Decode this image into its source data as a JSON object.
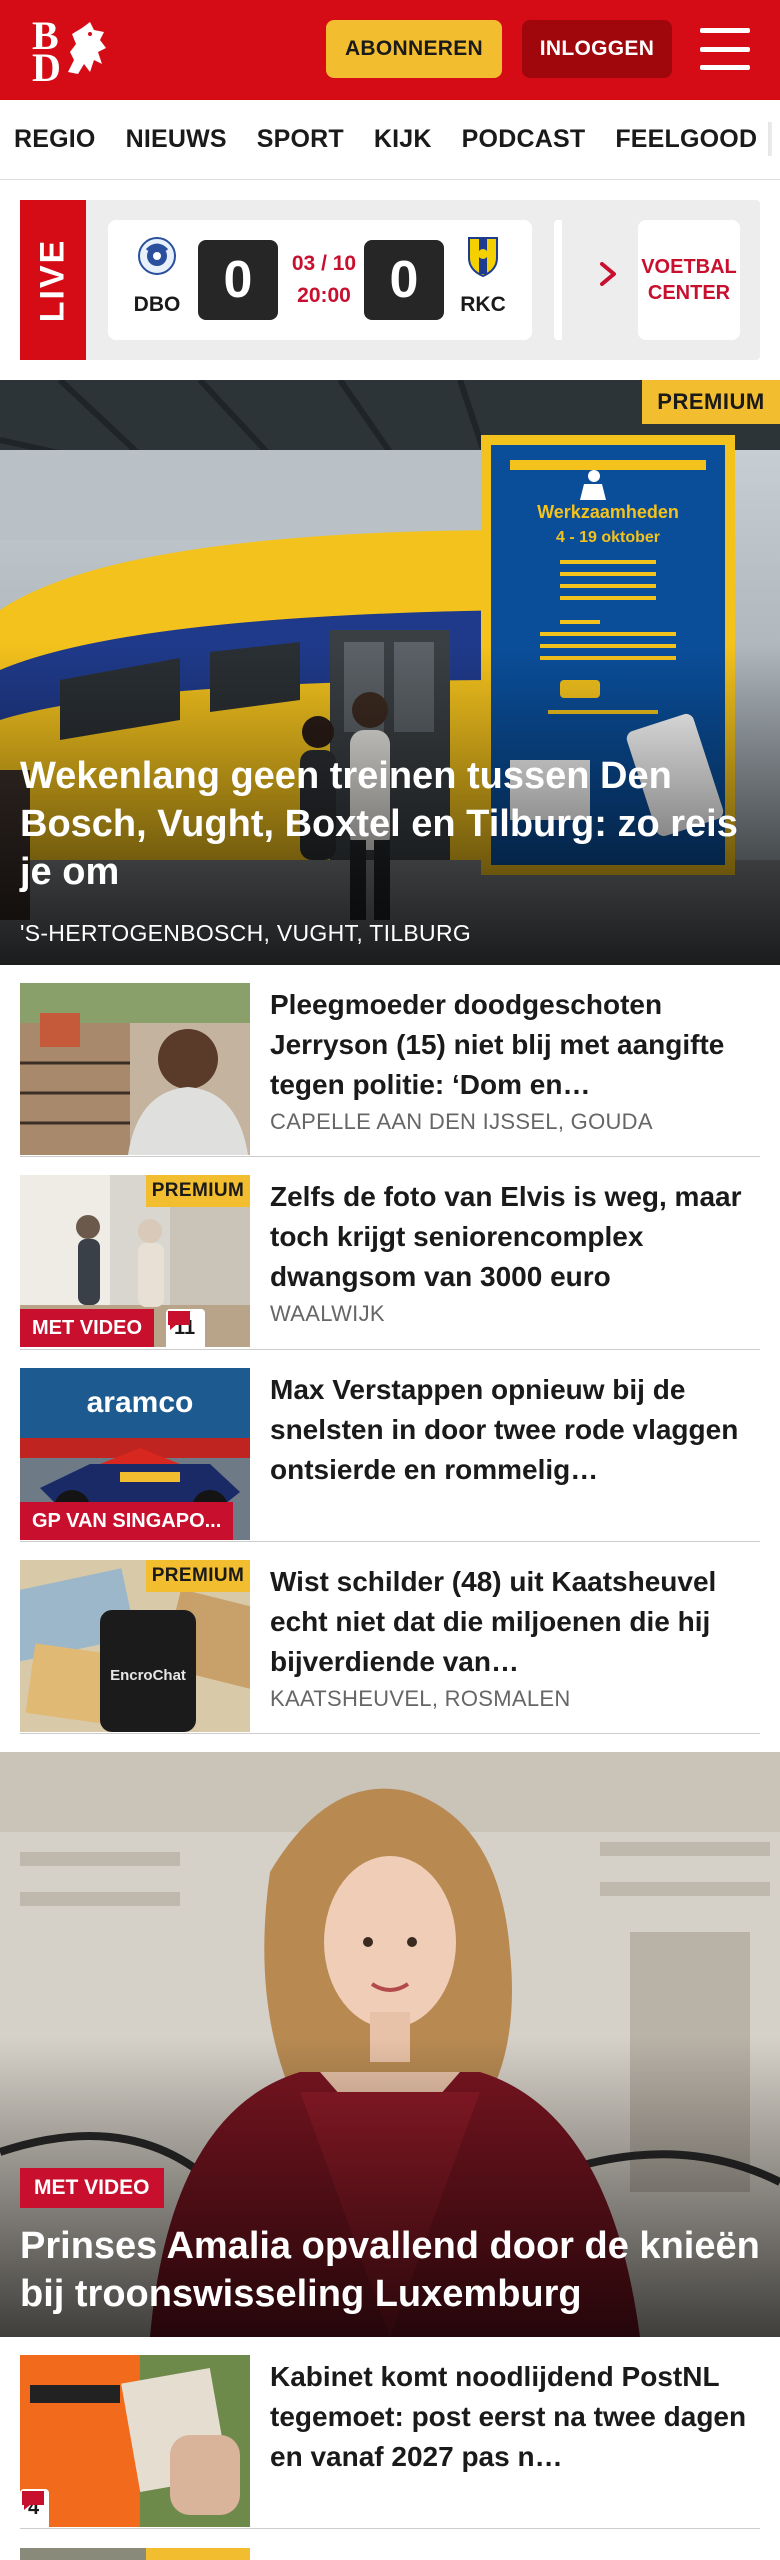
{
  "header": {
    "logo_text": "BD",
    "subscribe_label": "ABONNEREN",
    "login_label": "INLOGGEN",
    "brand_color": "#d50c16"
  },
  "nav": {
    "items": [
      "REGIO",
      "NIEUWS",
      "SPORT",
      "KIJK",
      "PODCAST",
      "FEELGOOD"
    ]
  },
  "live": {
    "label": "LIVE",
    "match": {
      "home": "DBO",
      "away": "RKC",
      "home_score": "0",
      "away_score": "0",
      "date": "03 / 10",
      "time": "20:00"
    },
    "voetbal_center": "VOETBAL CENTER"
  },
  "hero": {
    "badge": "PREMIUM",
    "title": "Wekenlang geen treinen tussen Den Bosch, Vught, Boxtel en Tilburg: zo reis je om",
    "location": "'S-HERTOGENBOSCH, VUGHT, TILBURG",
    "sign_title": "Werkzaamheden 4 - 19 oktober"
  },
  "articles": [
    {
      "title": "Pleegmoeder doodgeschoten Jerryson (15) niet blij met aangifte tegen politie: ‘Dom en…",
      "location": "CAPELLE AAN DEN IJSSEL, GOUDA"
    },
    {
      "title": "Zelfs de foto van Elvis is weg, maar toch krijgt seniorencom­plex dwangsom van 3000 euro",
      "location": "WAALWIJK",
      "premium": "PREMIUM",
      "video_badge": "MET VIDEO",
      "comments": "11"
    },
    {
      "title": "Max Verstappen opnieuw bij de snelsten in door twee rode vlaggen ontsierde en rommelig…",
      "label_badge": "GP VAN SINGAPO...",
      "thumb_text": "aramco"
    },
    {
      "title": "Wist schilder (48) uit Kaatsheu­vel echt niet dat die miljoenen die hij bijverdiende van…",
      "location": "KAATSHEUVEL, ROSMALEN",
      "premium": "PREMIUM",
      "thumb_text": "EncroChat"
    }
  ],
  "hero2": {
    "badge": "MET VIDEO",
    "title": "Prinses Amalia opvallend door de knieën bij troonswisseling Luxemburg"
  },
  "article5": {
    "title": "Kabinet komt noodlijdend PostNL tegemoet: post eerst na twee dagen en vanaf 2027 pas n…",
    "comments": "4"
  }
}
